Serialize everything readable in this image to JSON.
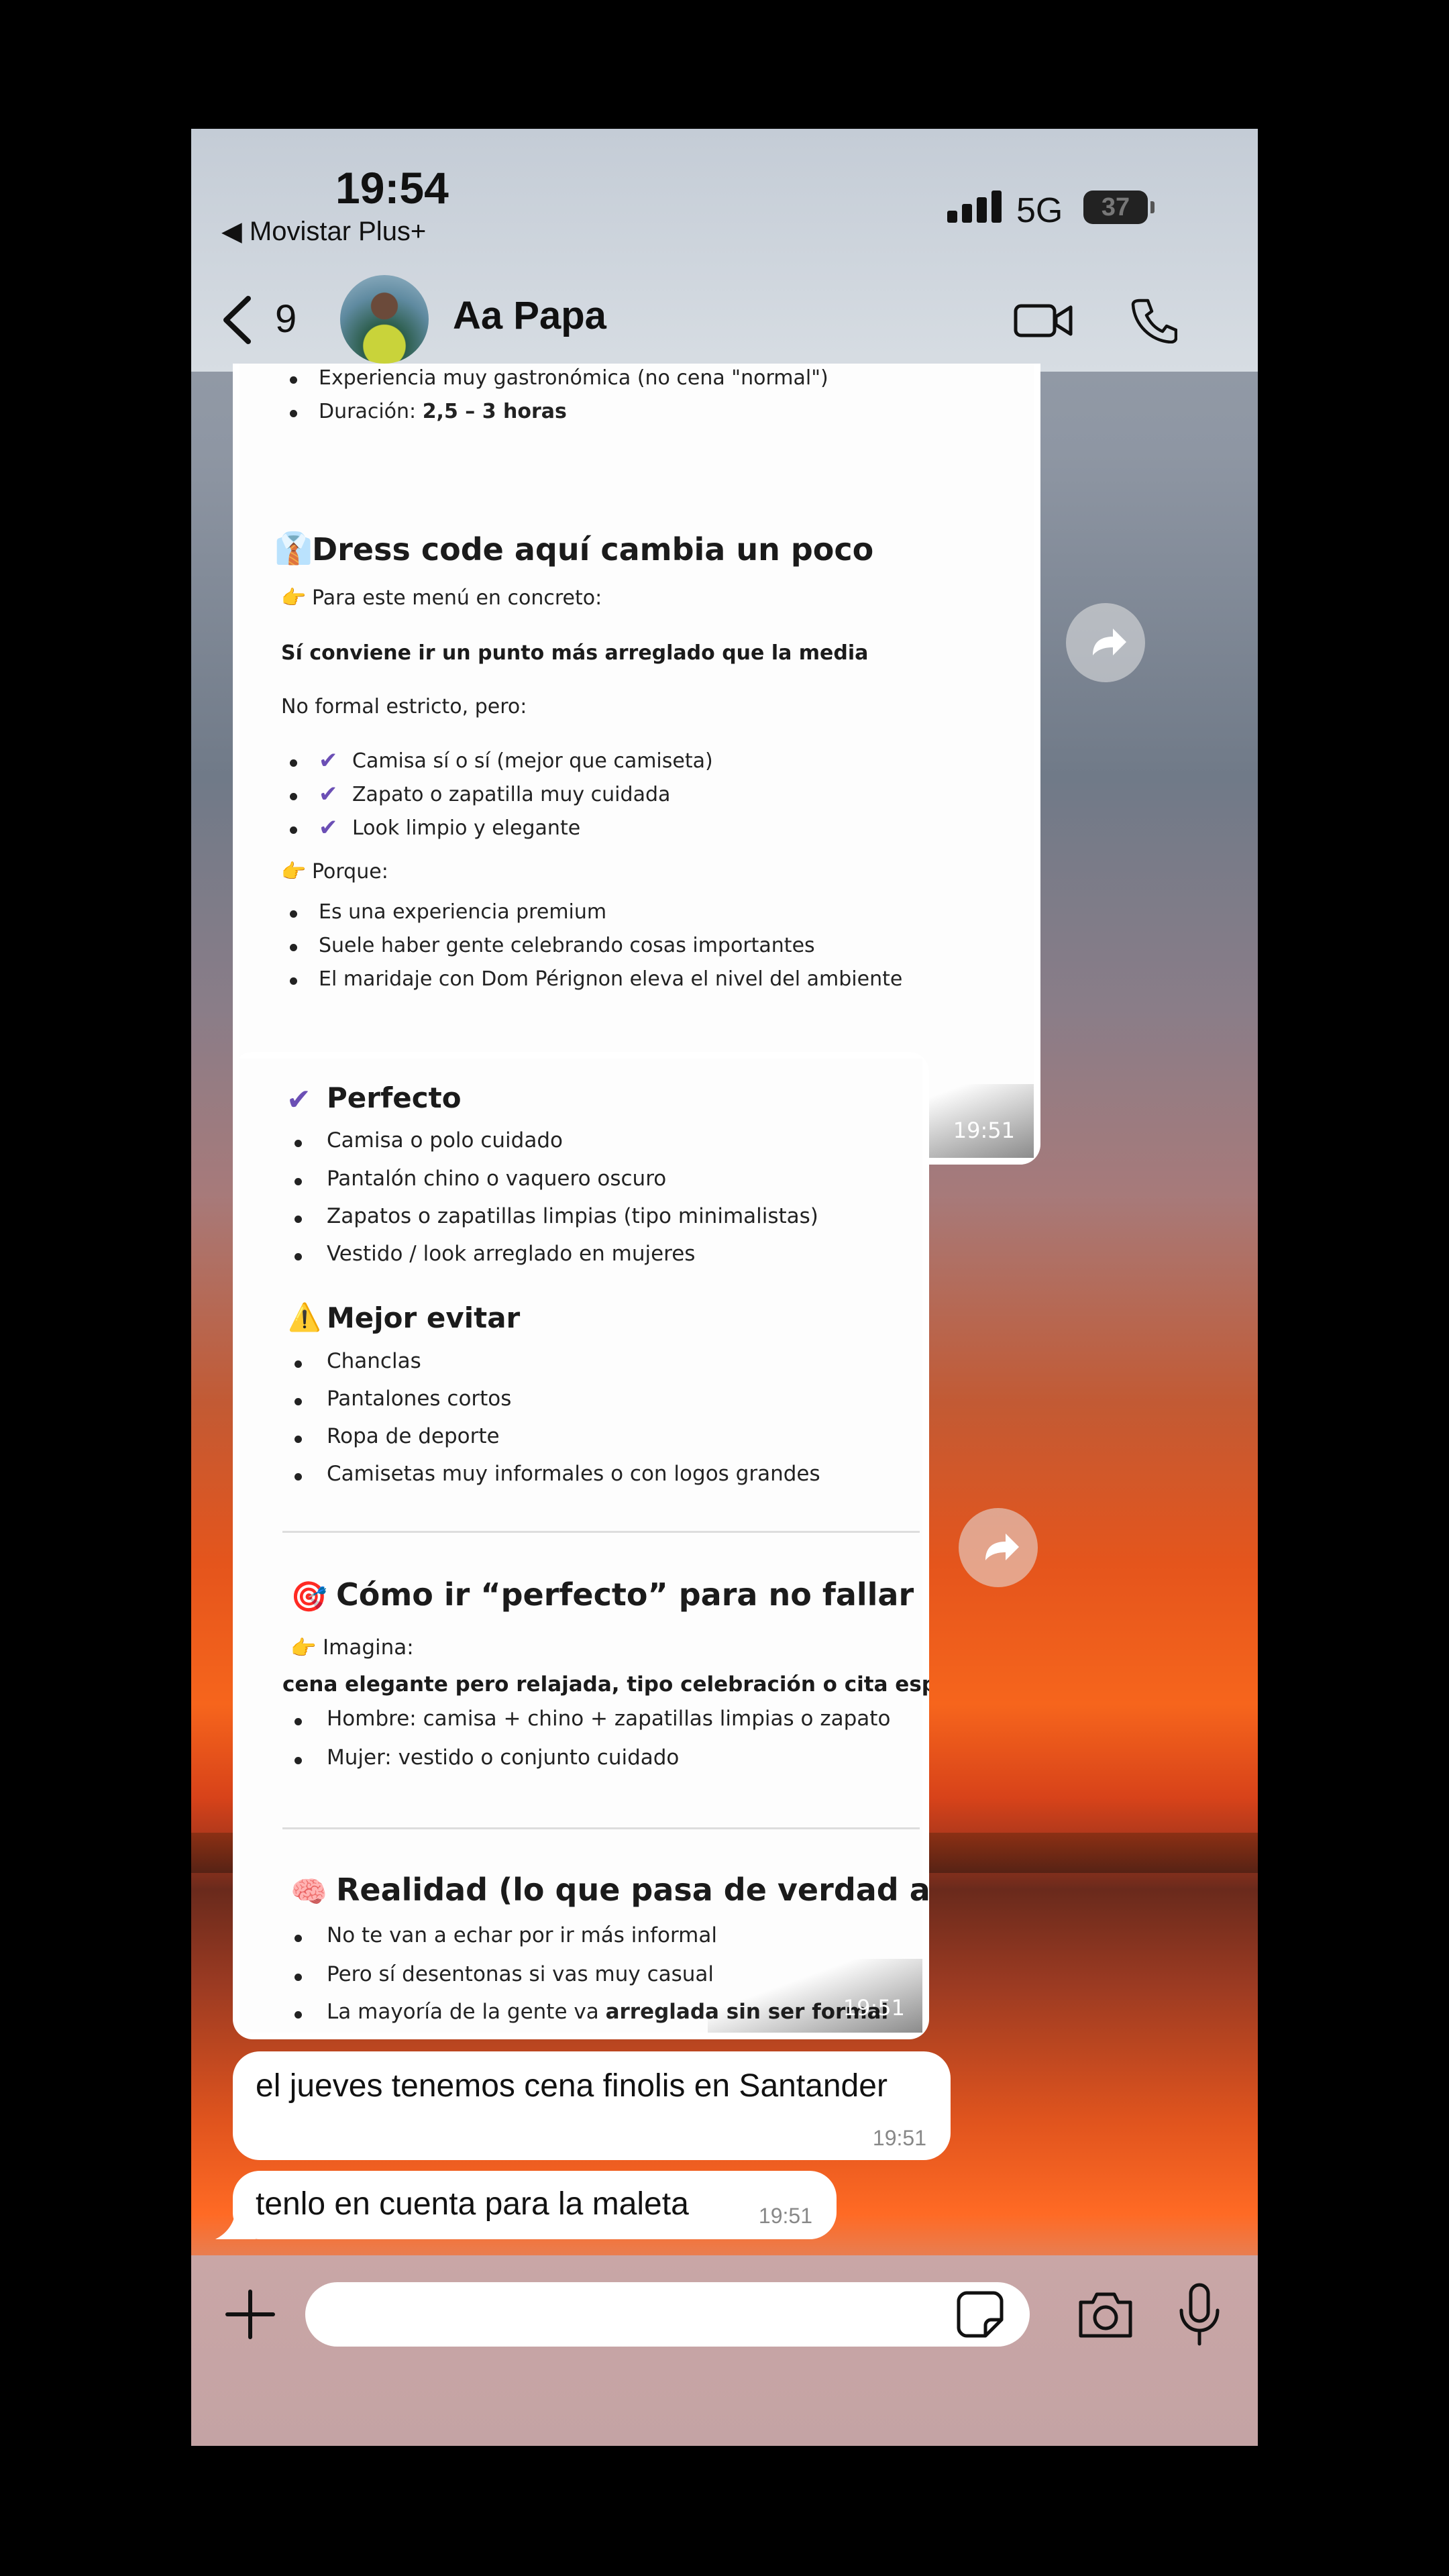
{
  "status": {
    "time": "19:54",
    "carrier": "◀ Movistar Plus+",
    "network": "5G",
    "battery": "37"
  },
  "header": {
    "back_count": "9",
    "contact_name": "Aa Papa"
  },
  "messages": {
    "image1": {
      "top_items": [
        {
          "text": "Experiencia muy gastronómica (no cena \"normal\")"
        },
        {
          "text": "Duración: ",
          "bold": "2,5 – 3 horas"
        }
      ],
      "dress_title": "Dress code aquí cambia un poco",
      "menu_intro": "Para este menú en concreto:",
      "recommend": "Sí conviene ir un punto más arreglado que la media",
      "no_formal": "No formal estricto, pero:",
      "checks": [
        "Camisa sí o sí (mejor que camiseta)",
        "Zapato o zapatilla muy cuidada",
        "Look limpio y elegante"
      ],
      "porque": "Porque:",
      "reasons": [
        "Es una experiencia premium",
        "Suele haber gente celebrando cosas importantes",
        "El maridaje con Dom Pérignon eleva el nivel del ambiente"
      ],
      "time": "19:51"
    },
    "image2": {
      "perfecto_title": "Perfecto",
      "perfecto_items": [
        "Camisa o polo cuidado",
        "Pantalón chino o vaquero oscuro",
        "Zapatos o zapatillas limpias (tipo minimalistas)",
        "Vestido / look arreglado en mujeres"
      ],
      "evitar_title": "Mejor evitar",
      "evitar_items": [
        "Chanclas",
        "Pantalones cortos",
        "Ropa de deporte",
        "Camisetas muy informales o con logos grandes"
      ],
      "como_title": "Cómo ir “perfecto” para no fallar",
      "imagina": "Imagina:",
      "imagina_bold": "cena elegante pero relajada, tipo celebración o cita especial",
      "como_items": [
        "Hombre: camisa + chino + zapatillas limpias o zapato",
        "Mujer: vestido o conjunto cuidado"
      ],
      "realidad_title": "Realidad (lo que pasa de verdad allí)",
      "realidad_items": [
        "No te van a echar por ir más informal",
        "Pero sí desentonas si vas muy casual"
      ],
      "realidad_last": "La mayoría de la gente va ",
      "realidad_last_bold": "arreglada sin ser formal",
      "time": "19:51"
    },
    "text1": {
      "text": "el jueves tenemos cena finolis en Santander",
      "time": "19:51"
    },
    "text2": {
      "text": "tenlo en cuenta para la maleta",
      "time": "19:51"
    }
  },
  "colors": {
    "accent_check": "#6b4fb5",
    "bubble": "#ffffff"
  }
}
